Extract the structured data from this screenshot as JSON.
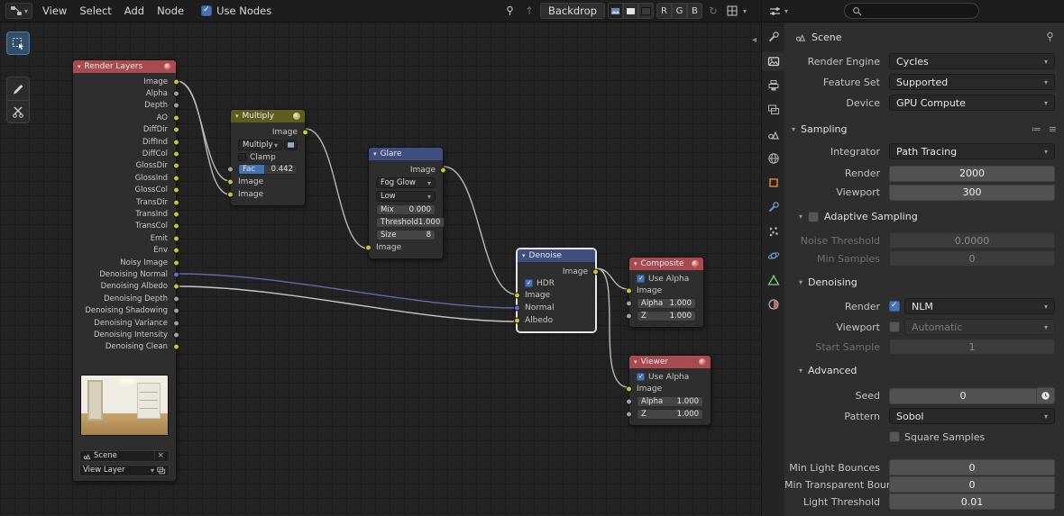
{
  "colors": {
    "accent_blue": "#4772b3",
    "node_header_red": "#a84a50",
    "node_header_blue": "#3e4e80",
    "node_header_olive": "#5d5d20",
    "socket_yellow": "#c6c62f",
    "socket_gray": "#a1a1a1",
    "socket_blue": "#6a6ac8"
  },
  "topbar": {
    "menus": [
      "View",
      "Select",
      "Add",
      "Node"
    ],
    "use_nodes_label": "Use Nodes",
    "backdrop_label": "Backdrop",
    "r_label": "R",
    "g_label": "G",
    "b_label": "B"
  },
  "nodes": {
    "render_layers": {
      "title": "Render Layers",
      "outputs": [
        {
          "label": "Image",
          "color": "#c6c62f"
        },
        {
          "label": "Alpha",
          "color": "#a1a1a1"
        },
        {
          "label": "Depth",
          "color": "#a1a1a1"
        },
        {
          "label": "AO",
          "color": "#c6c62f"
        },
        {
          "label": "DiffDir",
          "color": "#c6c62f"
        },
        {
          "label": "DiffInd",
          "color": "#c6c62f"
        },
        {
          "label": "DiffCol",
          "color": "#c6c62f"
        },
        {
          "label": "GlossDir",
          "color": "#c6c62f"
        },
        {
          "label": "GlossInd",
          "color": "#c6c62f"
        },
        {
          "label": "GlossCol",
          "color": "#c6c62f"
        },
        {
          "label": "TransDir",
          "color": "#c6c62f"
        },
        {
          "label": "TransInd",
          "color": "#c6c62f"
        },
        {
          "label": "TransCol",
          "color": "#c6c62f"
        },
        {
          "label": "Emit",
          "color": "#c6c62f"
        },
        {
          "label": "Env",
          "color": "#c6c62f"
        },
        {
          "label": "Noisy Image",
          "color": "#c6c62f"
        },
        {
          "label": "Denoising Normal",
          "color": "#6a6ac8"
        },
        {
          "label": "Denoising Albedo",
          "color": "#c6c62f"
        },
        {
          "label": "Denoising Depth",
          "color": "#a1a1a1"
        },
        {
          "label": "Denoising Shadowing",
          "color": "#a1a1a1"
        },
        {
          "label": "Denoising Variance",
          "color": "#a1a1a1"
        },
        {
          "label": "Denoising Intensity",
          "color": "#a1a1a1"
        },
        {
          "label": "Denoising Clean",
          "color": "#c6c62f"
        }
      ],
      "scene_value": "Scene",
      "view_layer_value": "View Layer"
    },
    "multiply": {
      "title": "Multiply",
      "output_label": "Image",
      "mode_value": "Multiply",
      "clamp_label": "Clamp",
      "fac_label": "Fac",
      "fac_value": "0.442",
      "inputs": [
        {
          "label": "Image",
          "color": "#c6c62f"
        },
        {
          "label": "Image",
          "color": "#c6c62f"
        }
      ]
    },
    "glare": {
      "title": "Glare",
      "output_label": "Image",
      "type_value": "Fog Glow",
      "quality_value": "Low",
      "mix_label": "Mix",
      "mix_value": "0.000",
      "threshold_label": "Threshold",
      "threshold_value": "1.000",
      "size_label": "Size",
      "size_value": "8",
      "input_label": "Image"
    },
    "denoise": {
      "title": "Denoise",
      "output_label": "Image",
      "hdr_label": "HDR",
      "inputs": [
        {
          "label": "Image",
          "color": "#c6c62f"
        },
        {
          "label": "Normal",
          "color": "#6a6ac8"
        },
        {
          "label": "Albedo",
          "color": "#c6c62f"
        }
      ]
    },
    "composite": {
      "title": "Composite",
      "use_alpha_label": "Use Alpha",
      "input_label": "Image",
      "alpha_label": "Alpha",
      "alpha_value": "1.000",
      "z_label": "Z",
      "z_value": "1.000"
    },
    "viewer": {
      "title": "Viewer",
      "use_alpha_label": "Use Alpha",
      "input_label": "Image",
      "alpha_label": "Alpha",
      "alpha_value": "1.000",
      "z_label": "Z",
      "z_value": "1.000"
    }
  },
  "properties": {
    "nav_title": "Scene",
    "render_engine": {
      "label": "Render Engine",
      "value": "Cycles"
    },
    "feature_set": {
      "label": "Feature Set",
      "value": "Supported"
    },
    "device": {
      "label": "Device",
      "value": "GPU Compute"
    },
    "sampling": {
      "title": "Sampling",
      "integrator": {
        "label": "Integrator",
        "value": "Path Tracing"
      },
      "render": {
        "label": "Render",
        "value": "2000"
      },
      "viewport": {
        "label": "Viewport",
        "value": "300"
      },
      "adaptive": {
        "title": "Adaptive Sampling",
        "checked": false,
        "noise_threshold": {
          "label": "Noise Threshold",
          "value": "0.0000"
        },
        "min_samples": {
          "label": "Min Samples",
          "value": "0"
        }
      },
      "denoising": {
        "title": "Denoising",
        "render": {
          "label": "Render",
          "checked": true,
          "value": "NLM"
        },
        "viewport": {
          "label": "Viewport",
          "checked": false,
          "value": "Automatic"
        },
        "start_sample": {
          "label": "Start Sample",
          "value": "1"
        }
      },
      "advanced": {
        "title": "Advanced",
        "seed": {
          "label": "Seed",
          "value": "0"
        },
        "pattern": {
          "label": "Pattern",
          "value": "Sobol"
        },
        "square_samples": {
          "label": "Square Samples",
          "checked": false
        },
        "min_light_bounces": {
          "label": "Min Light Bounces",
          "value": "0"
        },
        "min_transparent_bounces": {
          "label": "Min Transparent Bounc...",
          "value": "0"
        },
        "light_threshold": {
          "label": "Light Threshold",
          "value": "0.01"
        }
      }
    }
  }
}
